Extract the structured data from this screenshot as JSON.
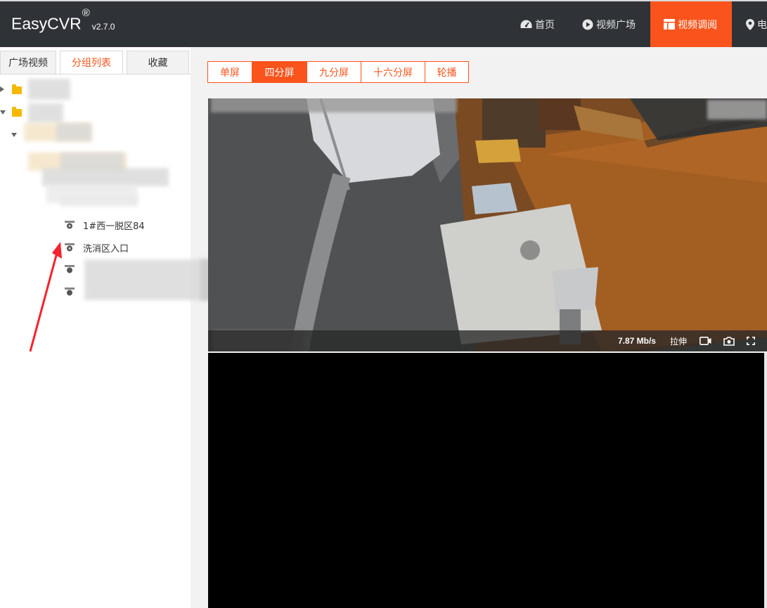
{
  "app": {
    "name": "EasyCVR",
    "reg": "®",
    "version": "v2.7.0"
  },
  "nav": [
    {
      "label": "首页",
      "icon": "dashboard-icon"
    },
    {
      "label": "视频广场",
      "icon": "play-circle-icon"
    },
    {
      "label": "视频调阅",
      "icon": "layout-icon",
      "active": true
    },
    {
      "label": "电",
      "icon": "map-pin-icon"
    }
  ],
  "sidebar": {
    "tabs": [
      {
        "label": "广场视频"
      },
      {
        "label": "分组列表",
        "active": true
      },
      {
        "label": "收藏"
      }
    ],
    "tree": {
      "devices": [
        {
          "label": "1#西一脱区84"
        },
        {
          "label": "洗消区入口"
        }
      ]
    }
  },
  "split_buttons": [
    {
      "label": "单屏"
    },
    {
      "label": "四分屏",
      "active": true
    },
    {
      "label": "九分屏"
    },
    {
      "label": "十六分屏"
    },
    {
      "label": "轮播"
    }
  ],
  "player": {
    "bitrate": "7.87 Mb/s",
    "stretch_label": "拉伸",
    "icons": [
      "record-icon",
      "camera-icon",
      "fullscreen-icon"
    ]
  },
  "colors": {
    "accent": "#fa541c",
    "header": "#2f3237"
  }
}
